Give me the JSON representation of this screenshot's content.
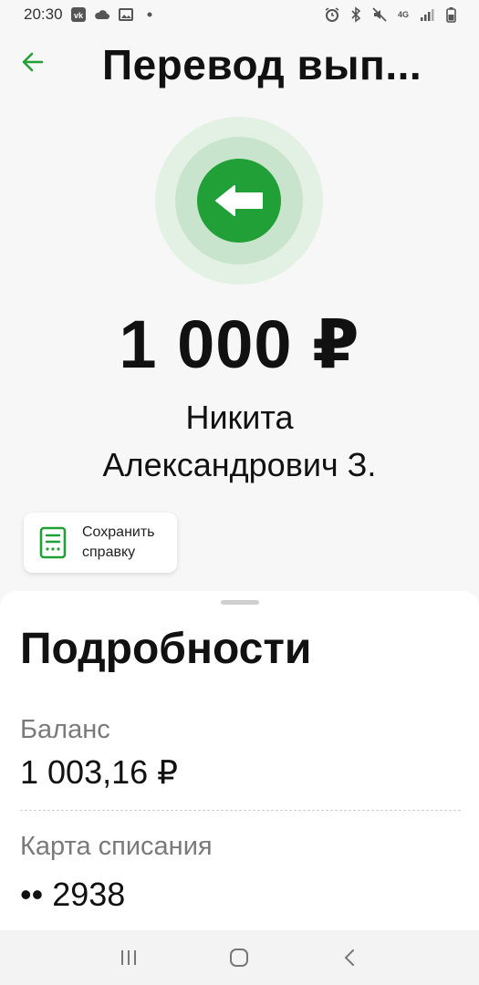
{
  "status_bar": {
    "time": "20:30",
    "network": "4G",
    "left_icons": [
      "vk-icon",
      "cloud-icon",
      "image-icon",
      "dot-icon"
    ],
    "right_icons": [
      "alarm-icon",
      "bluetooth-icon",
      "mute-icon",
      "network-4g-icon",
      "signal-icon",
      "battery-icon"
    ]
  },
  "header": {
    "title": "Перевод вып..."
  },
  "transfer": {
    "amount": "1 000 ₽",
    "recipient_line1": "Никита",
    "recipient_line2": "Александрович З."
  },
  "actions": {
    "save_receipt": "Сохранить справку"
  },
  "details": {
    "title": "Подробности",
    "balance_label": "Баланс",
    "balance_value": "1 003,16 ₽",
    "card_label": "Карта списания",
    "card_value": "•• 2938"
  },
  "colors": {
    "accent": "#21a038",
    "ring_outer": "#e3f1e5",
    "ring_inner": "#c9e4cd",
    "background": "#f7f7f7"
  }
}
